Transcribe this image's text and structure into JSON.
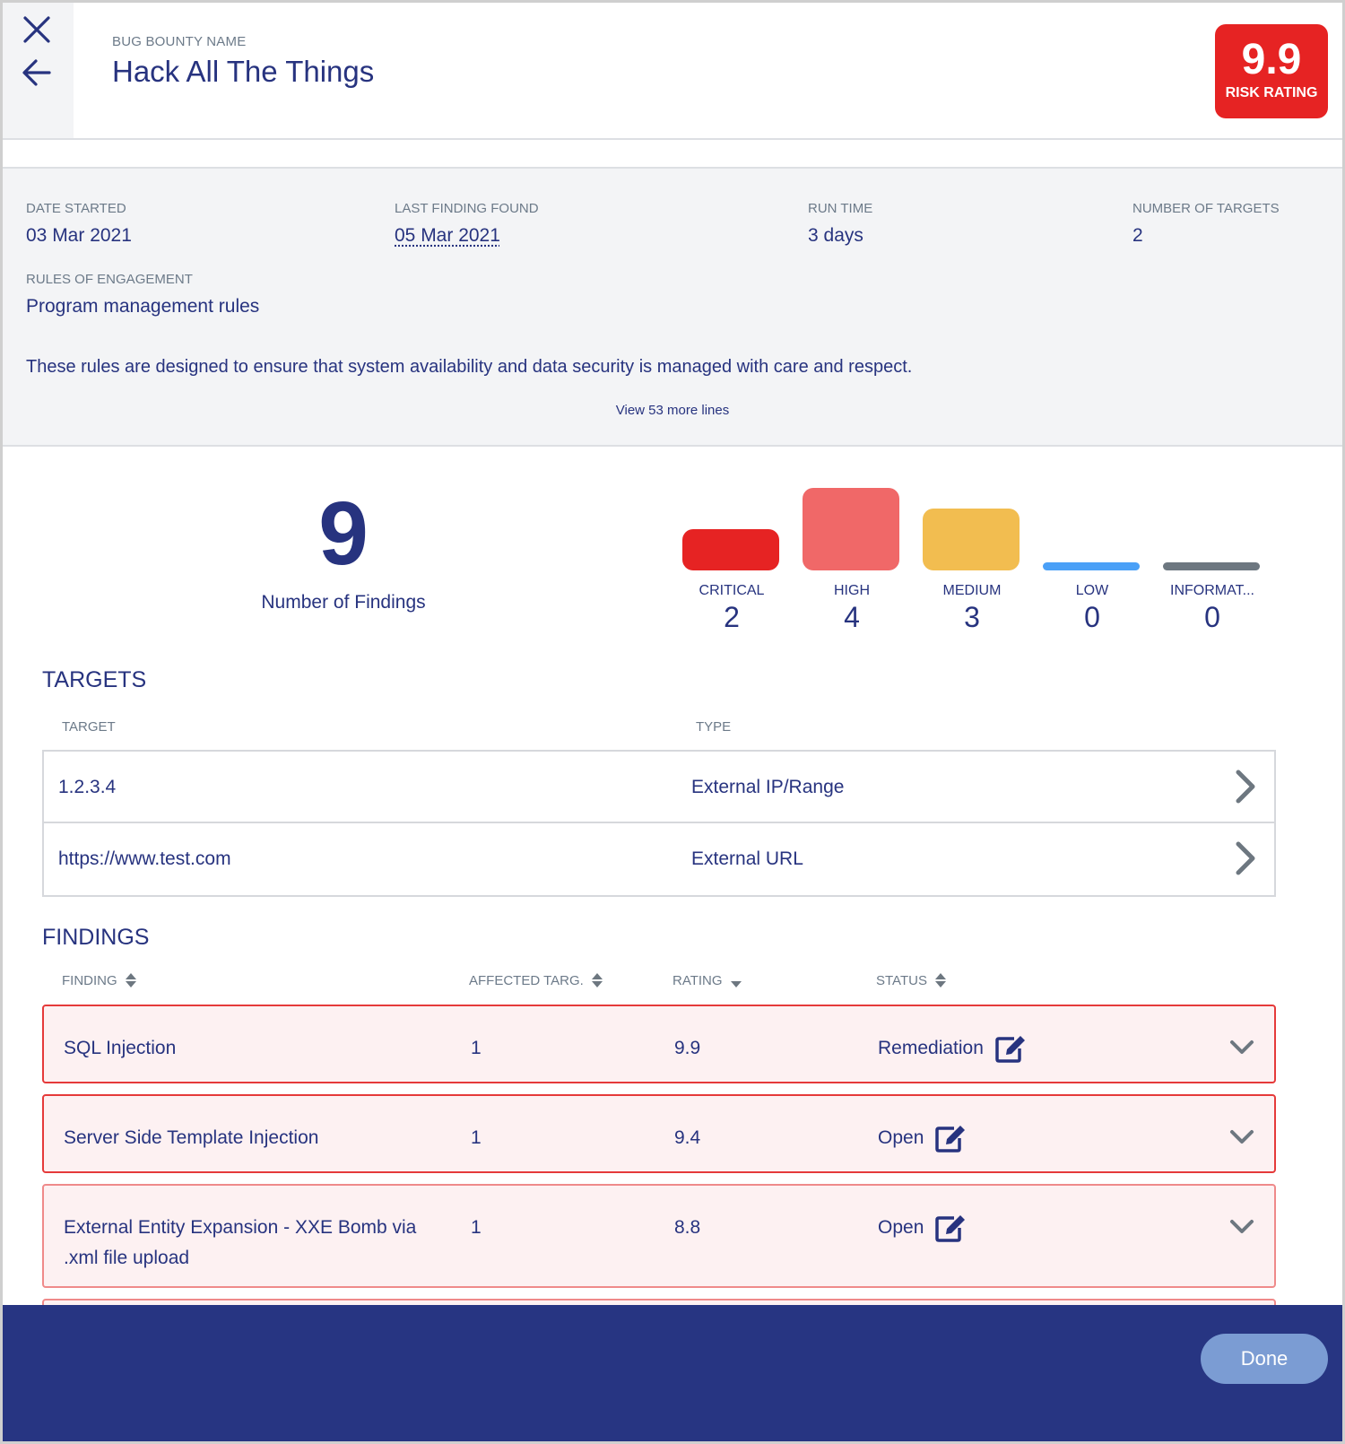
{
  "header": {
    "title_label": "BUG BOUNTY NAME",
    "title": "Hack All The Things",
    "close_icon": "close-icon",
    "back_icon": "arrow-left-icon",
    "risk_rating": {
      "value": "9.9",
      "label": "RISK RATING",
      "color": "#e62323"
    }
  },
  "info": {
    "date_started": {
      "label": "DATE STARTED",
      "value": "03 Mar 2021"
    },
    "last_finding": {
      "label": "LAST FINDING FOUND",
      "value": "05 Mar 2021"
    },
    "run_time": {
      "label": "RUN TIME",
      "value": "3 days"
    },
    "num_targets": {
      "label": "NUMBER OF TARGETS",
      "value": "2"
    },
    "rules": {
      "label": "RULES OF ENGAGEMENT",
      "value": "Program management rules"
    },
    "rules_description": "These rules are designed to ensure that system availability and data security is managed with care and respect.",
    "view_more": "View 53 more lines"
  },
  "summary": {
    "total": "9",
    "total_label": "Number of Findings",
    "severities": [
      {
        "label": "CRITICAL",
        "count": 2,
        "color": "#e62323"
      },
      {
        "label": "HIGH",
        "count": 4,
        "color": "#f06868"
      },
      {
        "label": "MEDIUM",
        "count": 3,
        "color": "#f2bd50"
      },
      {
        "label": "LOW",
        "count": 0,
        "color": "#4aa0f7"
      },
      {
        "label": "INFORMAT...",
        "count": 0,
        "color": "#6d7780"
      }
    ]
  },
  "targets": {
    "title": "TARGETS",
    "columns": [
      "TARGET",
      "TYPE"
    ],
    "rows": [
      {
        "target": "1.2.3.4",
        "type": "External IP/Range"
      },
      {
        "target": "https://www.test.com",
        "type": "External URL"
      }
    ]
  },
  "findings": {
    "title": "FINDINGS",
    "columns": [
      {
        "label": "FINDING",
        "sort": "both"
      },
      {
        "label": "AFFECTED TARG.",
        "sort": "both"
      },
      {
        "label": "RATING",
        "sort": "desc"
      },
      {
        "label": "STATUS",
        "sort": "both"
      }
    ],
    "rows": [
      {
        "name": "SQL Injection",
        "affected": "1",
        "rating": "9.9",
        "status": "Remediation",
        "severity": "critical"
      },
      {
        "name": "Server Side Template Injection",
        "affected": "1",
        "rating": "9.4",
        "status": "Open",
        "severity": "critical"
      },
      {
        "name": "External Entity Expansion - XXE Bomb via .xml file upload",
        "affected": "1",
        "rating": "8.8",
        "status": "Open",
        "severity": "high"
      }
    ]
  },
  "footer": {
    "done_label": "Done"
  }
}
